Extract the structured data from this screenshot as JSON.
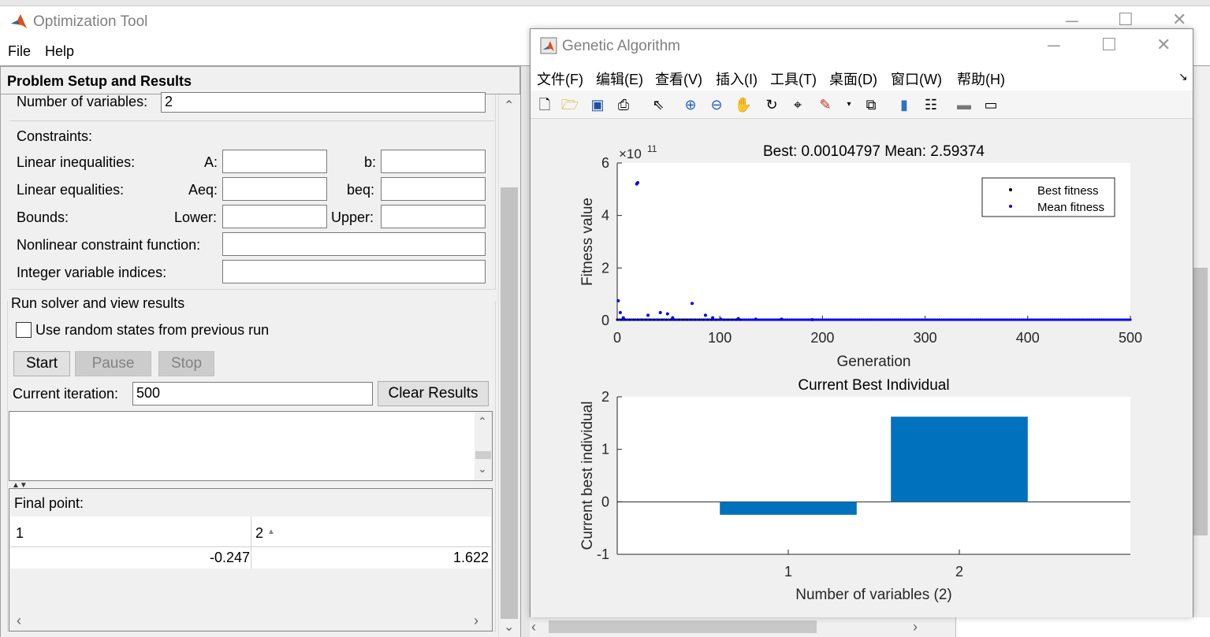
{
  "optim": {
    "title": "Optimization Tool",
    "menu": [
      "File",
      "Help"
    ],
    "panel_title": "Problem Setup and Results",
    "num_vars_label": "Number of variables:",
    "num_vars_value": "2",
    "constraints_label": "Constraints:",
    "lin_ineq_label": "Linear inequalities:",
    "a_label": "A:",
    "b_label": "b:",
    "lin_eq_label": "Linear equalities:",
    "aeq_label": "Aeq:",
    "beq_label": "beq:",
    "bounds_label": "Bounds:",
    "lower_label": "Lower:",
    "upper_label": "Upper:",
    "nonlin_label": "Nonlinear constraint function:",
    "int_label": "Integer variable indices:",
    "run_section": "Run solver and view results",
    "random_states_label": "Use random states from previous run",
    "start_label": "Start",
    "pause_label": "Pause",
    "stop_label": "Stop",
    "iter_label": "Current iteration:",
    "iter_value": "500",
    "clear_label": "Clear Results",
    "final_point_label": "Final point:",
    "col_headers": [
      "1",
      "2"
    ],
    "final_values": [
      "-0.247",
      "1.622"
    ]
  },
  "ga": {
    "title": "Genetic Algorithm",
    "menu": [
      "文件(F)",
      "编辑(E)",
      "查看(V)",
      "插入(I)",
      "工具(T)",
      "桌面(D)",
      "窗口(W)",
      "帮助(H)"
    ]
  },
  "chart_data": [
    {
      "type": "scatter",
      "title": "Best: 0.00104797 Mean: 2.59374",
      "xlabel": "Generation",
      "ylabel": "Fitness value",
      "exponent_label": "×10",
      "exponent": "11",
      "xlim": [
        0,
        500
      ],
      "ylim": [
        0,
        6
      ],
      "xticks": [
        "0",
        "100",
        "200",
        "300",
        "400",
        "500"
      ],
      "yticks": [
        "0",
        "2",
        "4",
        "6"
      ],
      "legend": [
        "Best fitness",
        "Mean fitness"
      ],
      "legend_position": "top-right",
      "colors": {
        "best": "#000000",
        "mean": "#0000ff"
      },
      "mean_spikes": [
        [
          1,
          0.75
        ],
        [
          3,
          0.3
        ],
        [
          6,
          0.1
        ],
        [
          19,
          5.2
        ],
        [
          20,
          5.25
        ],
        [
          30,
          0.2
        ],
        [
          42,
          0.3
        ],
        [
          49,
          0.25
        ],
        [
          54,
          0.1
        ],
        [
          73,
          0.65
        ],
        [
          86,
          0.2
        ],
        [
          93,
          0.1
        ],
        [
          101,
          0.05
        ],
        [
          118,
          0.07
        ],
        [
          135,
          0.05
        ],
        [
          160,
          0.05
        ],
        [
          190,
          0.03
        ]
      ],
      "best_value": 0.00104797,
      "mean_value": 2.59374
    },
    {
      "type": "bar",
      "title": "Current Best Individual",
      "xlabel": "Number of variables (2)",
      "ylabel": "Current best individual",
      "categories": [
        "1",
        "2"
      ],
      "values": [
        -0.247,
        1.622
      ],
      "ylim": [
        -1,
        2
      ],
      "yticks": [
        "-1",
        "0",
        "1",
        "2"
      ],
      "color": "#0072bd"
    }
  ]
}
